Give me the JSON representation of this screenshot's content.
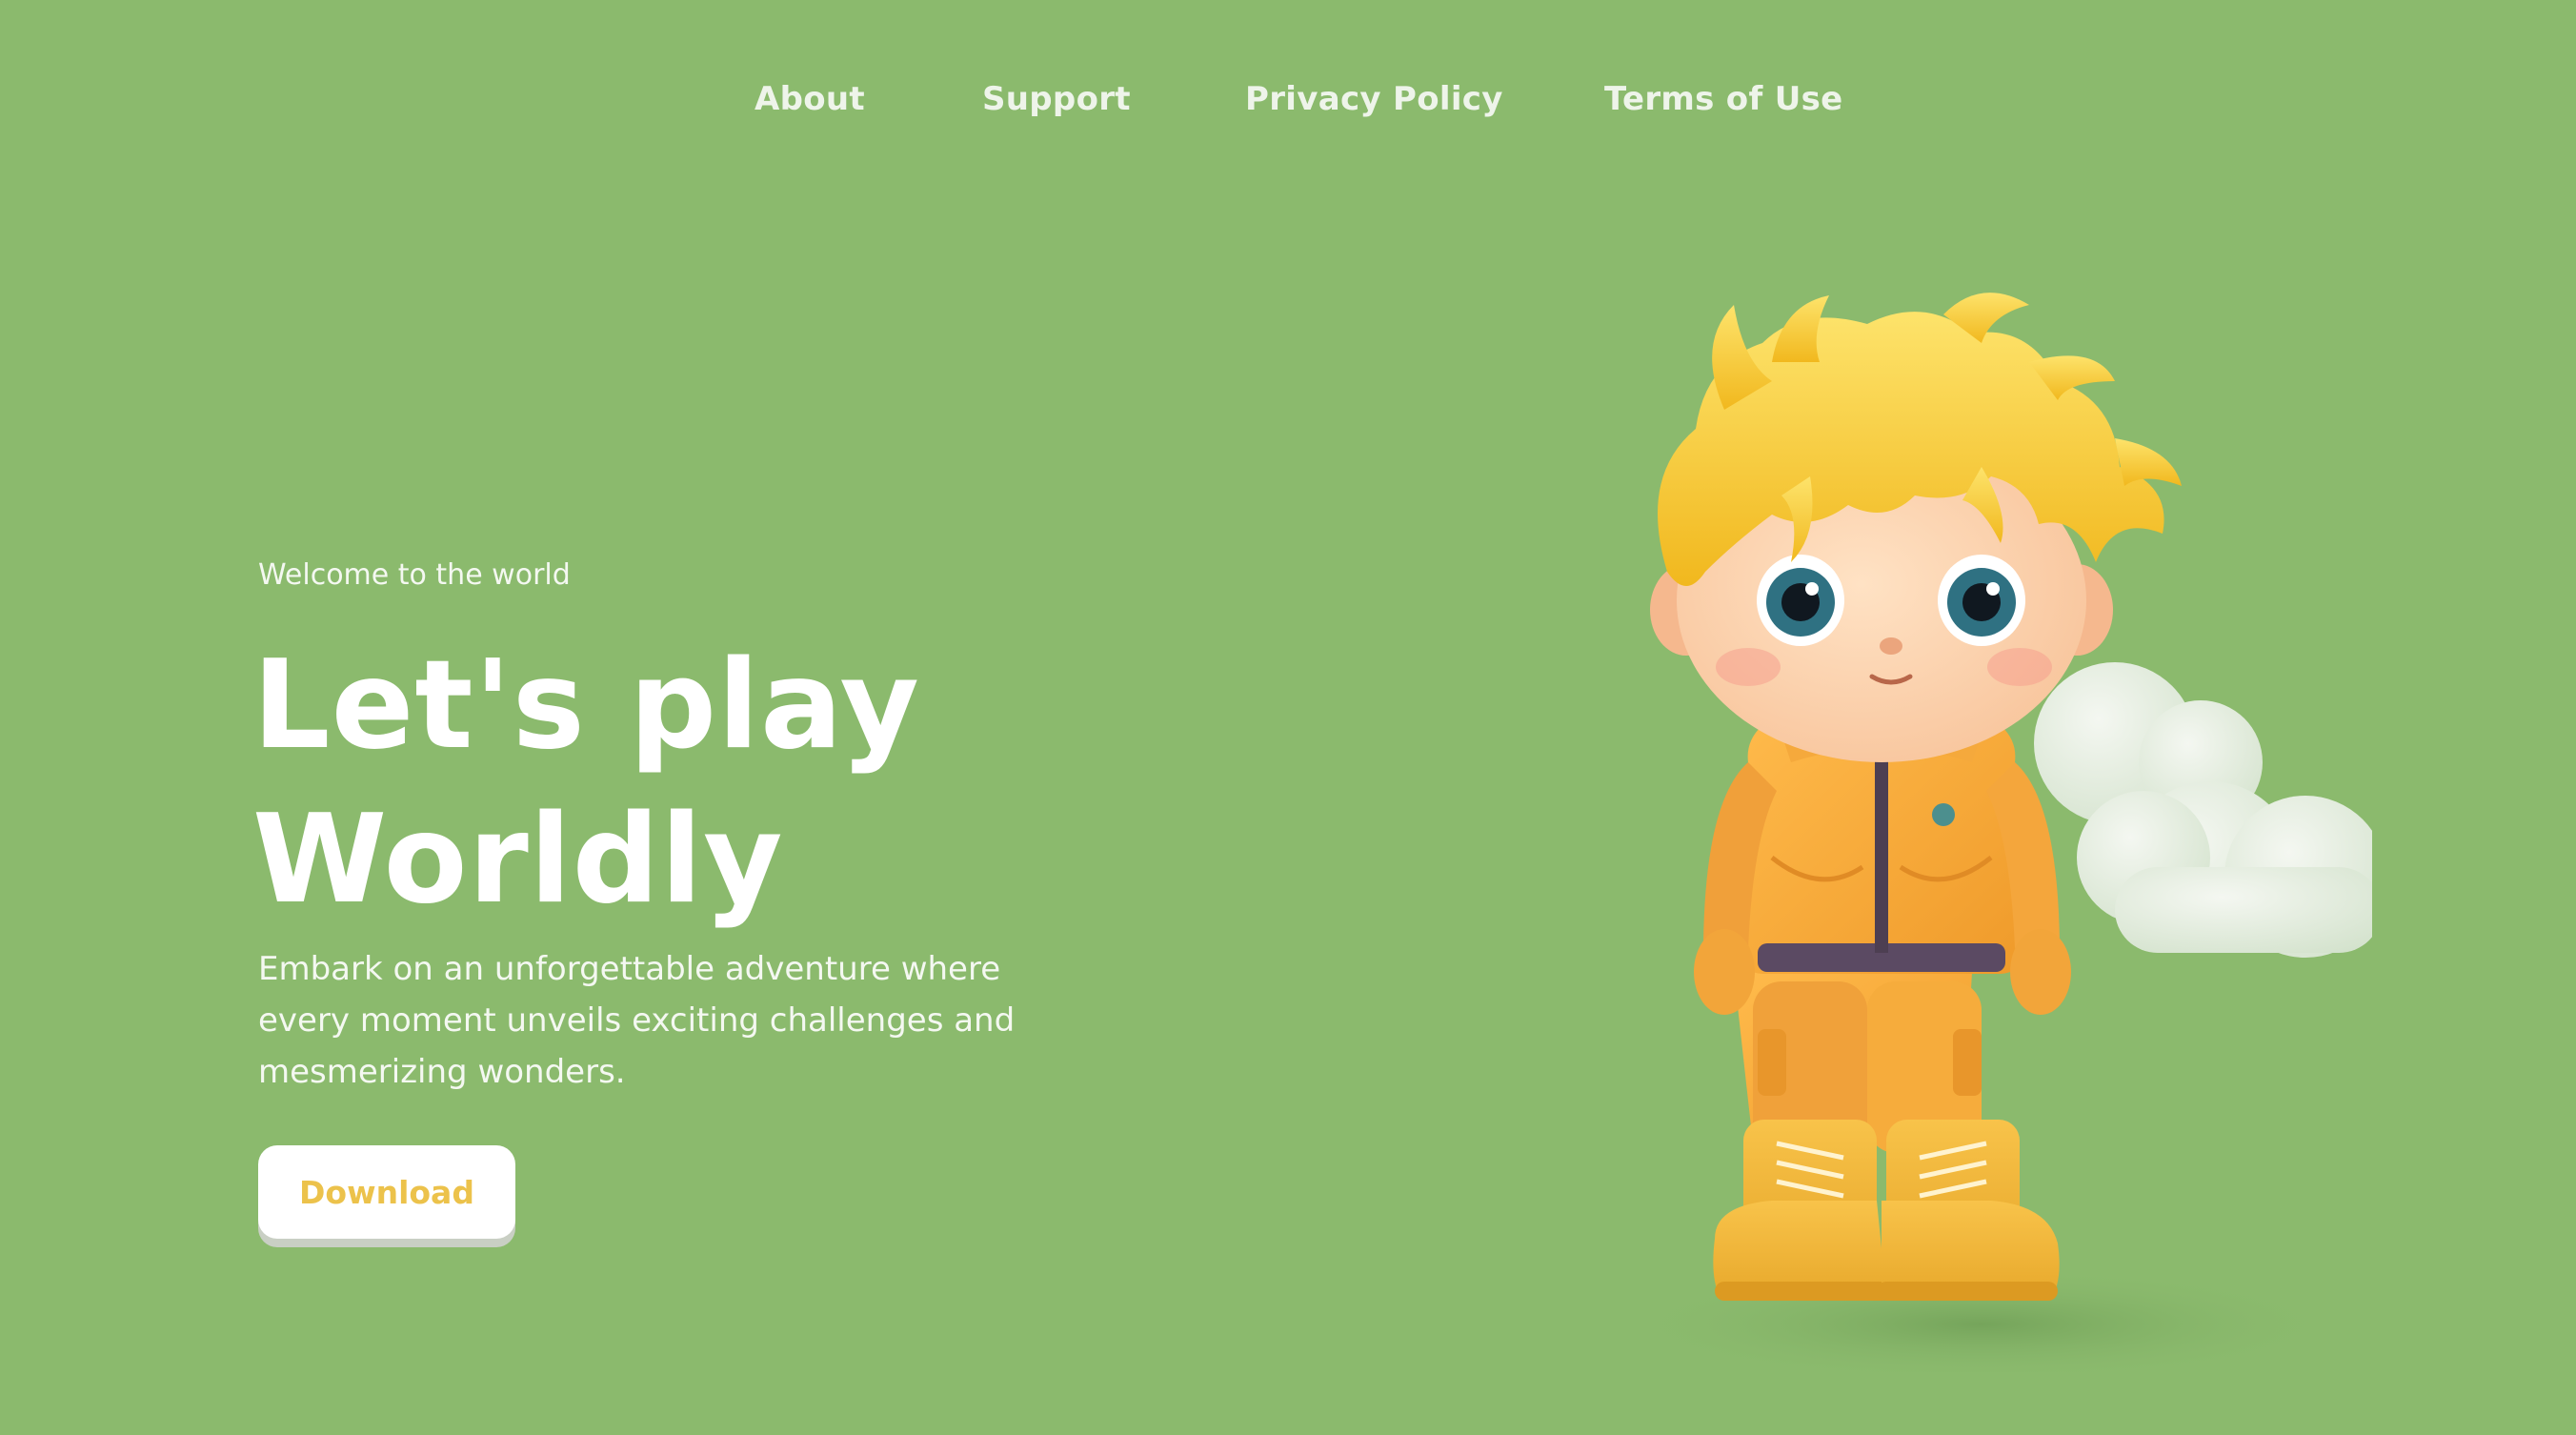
{
  "nav": {
    "about": "About",
    "support": "Support",
    "privacy": "Privacy Policy",
    "terms": "Terms of Use"
  },
  "hero": {
    "eyebrow": "Welcome to the world",
    "headline_line1": "Let's play",
    "headline_line2": "Worldly",
    "description": "Embark on an unforgettable adventure where every moment unveils exciting challenges and mesmerizing wonders.",
    "download_label": "Download"
  },
  "colors": {
    "background": "#8bba6d",
    "button_text": "#ecc24b",
    "character_jacket": "#f4a83a",
    "character_hair": "#f7cc2f",
    "cloud": "#e6ede3"
  },
  "illustration": {
    "subject": "3d-cartoon-boy-character-with-cloud"
  }
}
